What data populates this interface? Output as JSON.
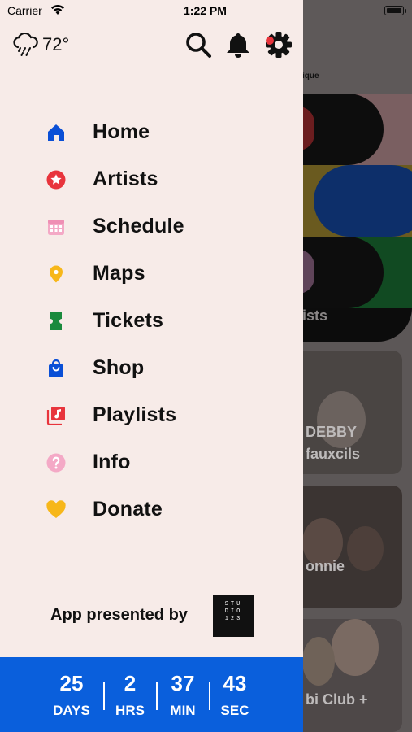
{
  "status_bar": {
    "carrier": "Carrier",
    "time": "1:22 PM"
  },
  "weather": {
    "temperature": "72°",
    "icon": "rain-cloud-icon"
  },
  "header_actions": [
    {
      "name": "search-icon"
    },
    {
      "name": "bell-icon"
    },
    {
      "name": "settings-gear-icon"
    }
  ],
  "menu": {
    "items": [
      {
        "label": "Home",
        "icon": "home-icon",
        "color": "#0a4fd6"
      },
      {
        "label": "Artists",
        "icon": "star-icon",
        "color": "#e8343c"
      },
      {
        "label": "Schedule",
        "icon": "calendar-icon",
        "color": "#f4a9c6"
      },
      {
        "label": "Maps",
        "icon": "map-pin-icon",
        "color": "#f7b71a"
      },
      {
        "label": "Tickets",
        "icon": "ticket-icon",
        "color": "#1a8a3d"
      },
      {
        "label": "Shop",
        "icon": "shopping-bag-icon",
        "color": "#0a4fd6"
      },
      {
        "label": "Playlists",
        "icon": "music-playlist-icon",
        "color": "#e8343c"
      },
      {
        "label": "Info",
        "icon": "question-icon",
        "color": "#f4a9c6"
      },
      {
        "label": "Donate",
        "icon": "heart-icon",
        "color": "#f7b71a"
      }
    ]
  },
  "footer": {
    "presented_by": "App presented by",
    "sponsor_logo": "STUDIO123"
  },
  "countdown": {
    "background": "#0a5fdc",
    "units": [
      {
        "value": "25",
        "label": "DAYS"
      },
      {
        "value": "2",
        "label": "HRS"
      },
      {
        "value": "37",
        "label": "MIN"
      },
      {
        "value": "43",
        "label": "SEC"
      }
    ]
  },
  "background_content": {
    "small_label": "ique",
    "banner_label": "ists",
    "cards": [
      {
        "line1": "DEBBY",
        "line2": "fauxcils"
      },
      {
        "line1": "onnie"
      },
      {
        "line1": "bi Club +"
      }
    ]
  }
}
